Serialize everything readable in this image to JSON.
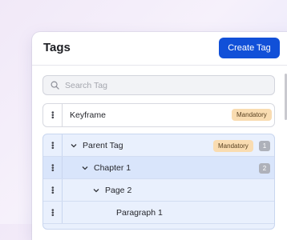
{
  "header": {
    "title": "Tags",
    "create_button": "Create Tag"
  },
  "search": {
    "placeholder": "Search Tag",
    "value": ""
  },
  "tags": [
    {
      "label": "Keyframe",
      "badge": "Mandatory",
      "count": ""
    },
    {
      "label": "Parent Tag",
      "badge": "Mandatory",
      "count": "1",
      "expanded": true,
      "level": 0
    },
    {
      "label": "Chapter 1",
      "badge": "",
      "count": "2",
      "expanded": true,
      "level": 1,
      "selected": true
    },
    {
      "label": "Page 2",
      "badge": "",
      "count": "",
      "expanded": true,
      "level": 2
    },
    {
      "label": "Paragraph 1",
      "badge": "",
      "count": "",
      "level": 3
    }
  ],
  "colors": {
    "primary": "#1150d8",
    "badge_bg": "#f9dcb1",
    "tree_bg": "#e9f0fd",
    "selected_bg": "#d9e5fb"
  },
  "icons": {
    "search": "search-icon",
    "grip": "drag-handle-icon",
    "chevron": "chevron-down-icon"
  }
}
